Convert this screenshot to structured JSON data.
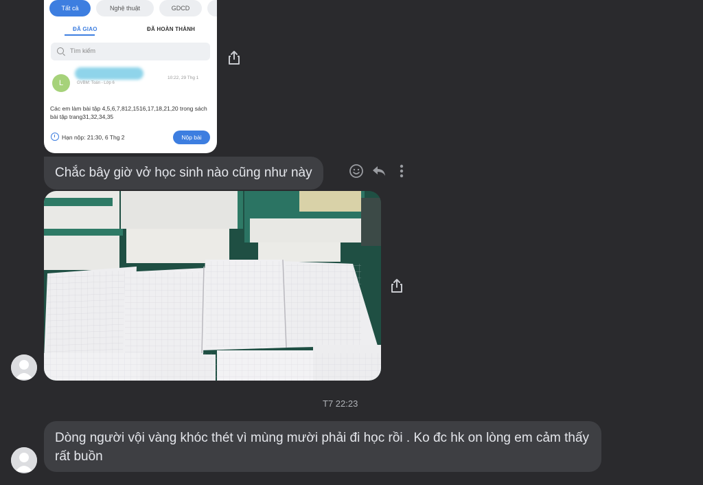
{
  "shared_screenshot": {
    "chips": [
      "Tất cả",
      "Nghệ thuật",
      "GDCD"
    ],
    "tabs": [
      "ĐÃ GIAO",
      "ĐÃ HOÀN THÀNH"
    ],
    "search_placeholder": "Tìm kiếm",
    "avatar_letter": "L",
    "teacher_meta": "GVBM: Toán - Lớp 6",
    "post_time": "10:22, 29 Thg 1",
    "assignment_text": "Các em làm bài tập 4,5,6,7,812,1516,17,18,21,20 trong sách bài tập trang31,32,34,35",
    "deadline": "Hạn nộp: 21:30, 6 Thg 2",
    "submit_label": "Nộp bài"
  },
  "messages": {
    "msg1": "Chắc bây giờ vở học sinh nào cũng như này",
    "timestamp": "T7 22:23",
    "msg2": "Dòng người vội vàng khóc thét vì mùng mười phải đi học rồi . Ko đc hk on lòng em cảm thấy rất buồn"
  },
  "icons": {
    "share": "share-icon",
    "emoji": "emoji-icon",
    "reply": "reply-icon",
    "more": "more-icon",
    "avatar": "default-avatar-icon"
  },
  "colors": {
    "background": "#2a2a2d",
    "bubble": "#3e3f43",
    "accent": "#3d7ee0"
  }
}
